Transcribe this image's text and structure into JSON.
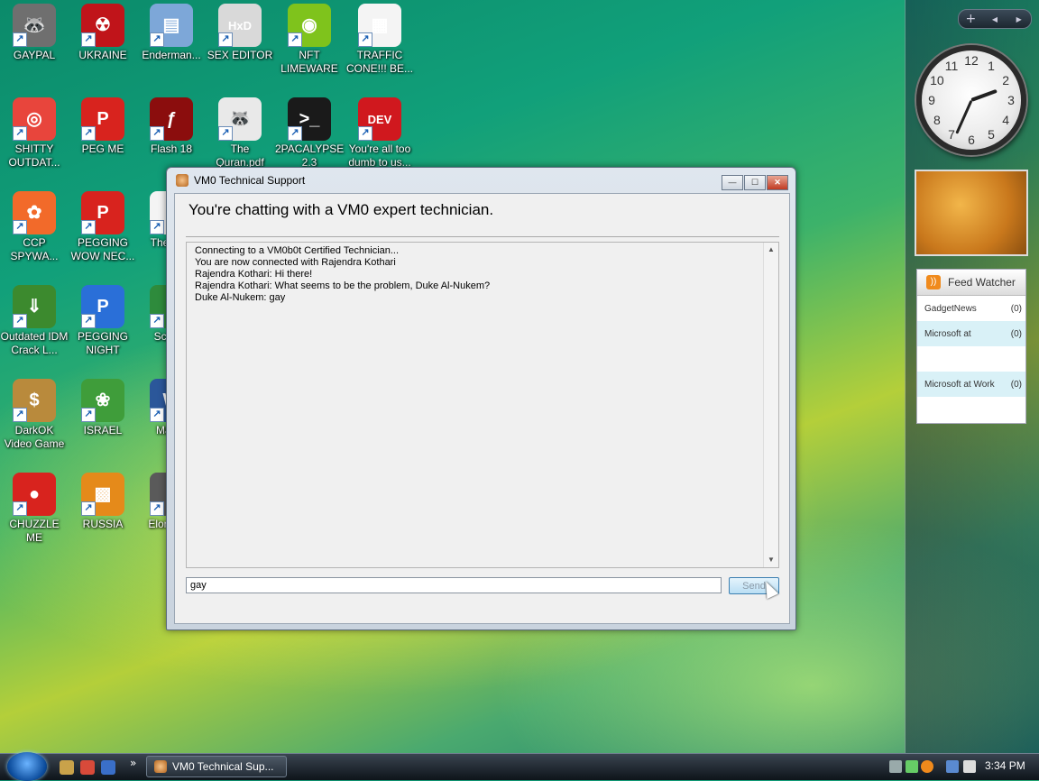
{
  "desktop_icons": [
    {
      "label": "GAYPAL",
      "icon": "raccoon-icon",
      "color": "#6f6f6f",
      "glyph": "🦝"
    },
    {
      "label": "UKRAINE",
      "icon": "radiation-icon",
      "color": "#c0141a",
      "glyph": "☢"
    },
    {
      "label": "Enderman...",
      "icon": "window-icon",
      "color": "#7da7d8",
      "glyph": "▤"
    },
    {
      "label": "SEX EDITOR",
      "icon": "hxd-icon",
      "color": "#d9d9d9",
      "glyph": "HxD"
    },
    {
      "label": "NFT LIMEWARE",
      "icon": "lime-icon",
      "color": "#7fc31c",
      "glyph": "◉"
    },
    {
      "label": "TRAFFIC CONE!!! BE...",
      "icon": "document-icon",
      "color": "#f4f4f4",
      "glyph": "▦"
    },
    {
      "label": "SHITTY OUTDAT...",
      "icon": "chrome-icon",
      "color": "#e8453c",
      "glyph": "◎"
    },
    {
      "label": "PEG ME",
      "icon": "peg-icon",
      "color": "#d8231e",
      "glyph": "P"
    },
    {
      "label": "Flash 18",
      "icon": "flash-icon",
      "color": "#8b0d0d",
      "glyph": "ƒ"
    },
    {
      "label": "The Quran.pdf",
      "icon": "raccoon-doc-icon",
      "color": "#e9e9e9",
      "glyph": "🦝"
    },
    {
      "label": "2PACALYPSE 2.3",
      "icon": "console-icon",
      "color": "#1a1a1a",
      "glyph": ">_"
    },
    {
      "label": "You're all too dumb to us...",
      "icon": "devcpp-icon",
      "color": "#d0181e",
      "glyph": "DEV"
    },
    {
      "label": "CCP SPYWA...",
      "icon": "photos-icon",
      "color": "#f26a2a",
      "glyph": "✿"
    },
    {
      "label": "PEGGING WOW NEC...",
      "icon": "peg-icon",
      "color": "#d8231e",
      "glyph": "P"
    },
    {
      "label": "The of Is",
      "icon": "document-icon",
      "color": "#f4f4f4",
      "glyph": "▯"
    },
    {
      "label": "Outdated IDM Crack L...",
      "icon": "idm-icon",
      "color": "#3c8a2e",
      "glyph": "⇓"
    },
    {
      "label": "PEGGING NIGHT",
      "icon": "peg-icon",
      "color": "#2a6fd8",
      "glyph": "P"
    },
    {
      "label": "Scrip S",
      "icon": "script-icon",
      "color": "#2e8b3c",
      "glyph": "▯"
    },
    {
      "label": "DarkOK Video Game",
      "icon": "moneybag-icon",
      "color": "#b98a3c",
      "glyph": "$"
    },
    {
      "label": "ISRAEL",
      "icon": "flower-icon",
      "color": "#3f9d3a",
      "glyph": "❀"
    },
    {
      "label": "Mas S",
      "icon": "word-icon",
      "color": "#2b579a",
      "glyph": "W"
    },
    {
      "label": "CHUZZLE ME",
      "icon": "chuzzle-icon",
      "color": "#d8231e",
      "glyph": "●"
    },
    {
      "label": "RUSSIA",
      "icon": "puzzle-icon",
      "color": "#e58a1a",
      "glyph": "▩"
    },
    {
      "label": "Elor ruine",
      "icon": "game-icon",
      "color": "#5a5a5a",
      "glyph": "▯"
    }
  ],
  "sidebar": {
    "controls": {
      "add": "+",
      "prev": "◀",
      "next": "▶"
    },
    "clock": {
      "numbers": [
        "12",
        "1",
        "2",
        "3",
        "4",
        "5",
        "6",
        "7",
        "8",
        "9",
        "10",
        "11"
      ]
    },
    "feed_watcher": {
      "title": "Feed Watcher",
      "rows": [
        {
          "name": "GadgetNews",
          "count": "(0)"
        },
        {
          "name": "Microsoft at",
          "count": "(0)"
        },
        {
          "name": "",
          "count": ""
        },
        {
          "name": "Microsoft at Work",
          "count": "(0)"
        },
        {
          "name": "",
          "count": ""
        }
      ]
    }
  },
  "window": {
    "title": "VM0 Technical Support",
    "heading": "You're chatting with a VM0 expert technician.",
    "log": [
      "Connecting to a VM0b0t Certified Technician...",
      "You are now connected with Rajendra Kothari",
      "Rajendra Kothari: Hi there!",
      "Rajendra Kothari: What seems to be the problem, Duke Al-Nukem?",
      "Duke Al-Nukem: gay"
    ],
    "input_value": "gay",
    "send_label": "Send",
    "buttons": {
      "minimize": "—",
      "maximize": "☐",
      "close": "✕"
    }
  },
  "taskbar": {
    "chevron": "»",
    "task_label": "VM0 Technical Sup...",
    "time": "3:34 PM"
  }
}
